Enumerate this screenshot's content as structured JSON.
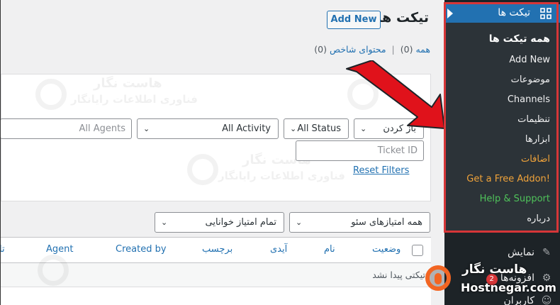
{
  "page": {
    "title": "تیکت ها",
    "add_new_label": "Add New"
  },
  "views": {
    "all_label": "همه",
    "all_count": "(0)",
    "featured_label": "محتوای شاخص",
    "featured_count": "(0)",
    "separator": "|"
  },
  "filters": {
    "bulk_select": "باز کردن",
    "status_select": "All Status",
    "activity_select": "All Activity",
    "agents_placeholder": "All Agents",
    "ticket_id_placeholder": "Ticket ID",
    "reset_label": "Reset Filters",
    "seo_scores_select": "همه امتیازهای سئو",
    "readability_select": "تمام امتیاز خوانایی"
  },
  "watermark": {
    "name": "هاست نگار",
    "tagline": "فناوری اطلاعات رایانگار"
  },
  "table": {
    "columns": [
      "وضعیت",
      "نام",
      "آیدی",
      "برچسب",
      "Created by",
      "Agent",
      "تا"
    ],
    "empty_message": "تیکتی پیدا نشد"
  },
  "sidebar": {
    "active_menu": {
      "label": "تیکت ها",
      "icon": "grid-icon"
    },
    "submenu": [
      {
        "label": "همه تیکت ها",
        "current": true
      },
      {
        "label": "Add New"
      },
      {
        "label": "موضوعات"
      },
      {
        "label": "Channels"
      },
      {
        "label": "تنظیمات"
      },
      {
        "label": "ابزارها"
      },
      {
        "label": "اضافات",
        "color": "#f0a33a"
      },
      {
        "label": "Get a Free Addon!",
        "color": "#f0a33a"
      },
      {
        "label": "Help & Support",
        "color": "#4fc25a"
      },
      {
        "label": "درباره"
      }
    ],
    "menu_below": [
      {
        "label": "نمایش",
        "icon": "brush-icon"
      },
      {
        "label": "افزونه‌ها",
        "icon": "plugin-icon",
        "badge": "2"
      },
      {
        "label": "کاربران",
        "icon": "users-icon"
      }
    ]
  },
  "brand": {
    "name_fa": "هاست نگار",
    "name_en": "Hostnegar.com"
  },
  "colors": {
    "accent": "#2271b1",
    "highlight_frame": "#d63638",
    "arrow": "#e0121b",
    "brand": "#f26522"
  }
}
